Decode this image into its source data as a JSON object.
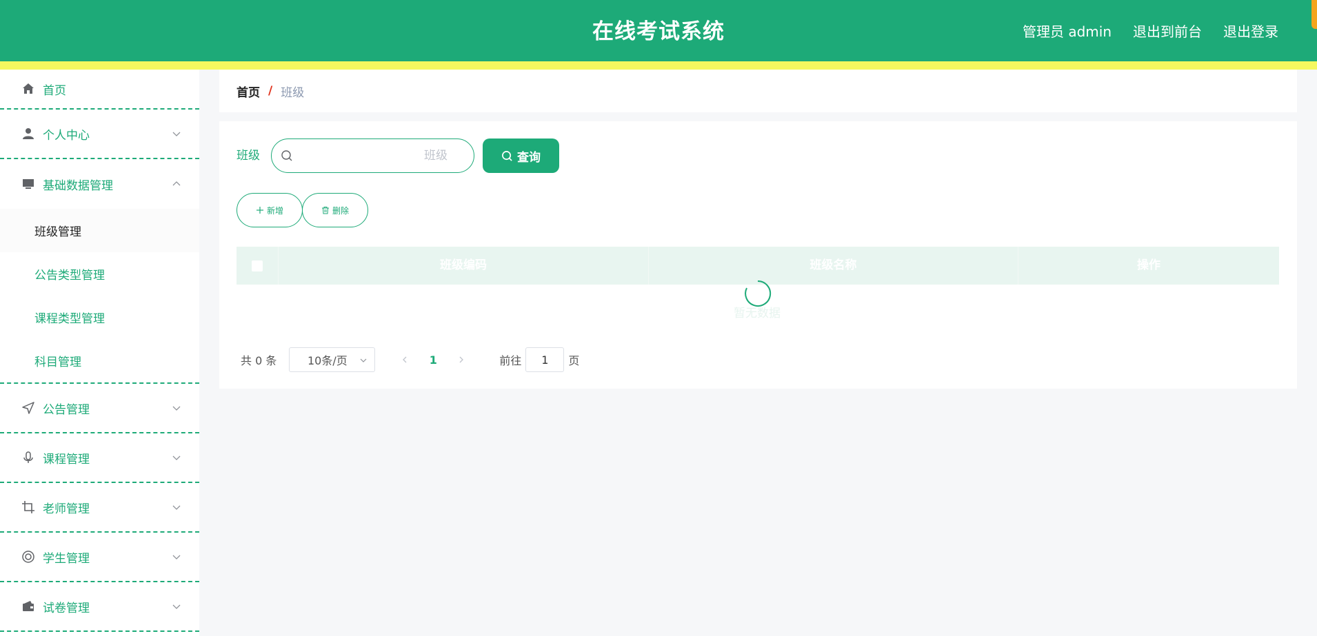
{
  "header": {
    "title": "在线考试系统",
    "admin_label": "管理员 admin",
    "exit_front": "退出到前台",
    "logout": "退出登录",
    "bg_color": "#1daa78",
    "stripe_color": "#f5f85f"
  },
  "sidebar": {
    "home": {
      "label": "首页",
      "icon": "home-icon"
    },
    "groups": [
      {
        "label": "个人中心",
        "icon": "user-icon",
        "expanded": false
      },
      {
        "label": "基础数据管理",
        "icon": "monitor-icon",
        "expanded": true,
        "children": [
          "班级管理",
          "公告类型管理",
          "课程类型管理",
          "科目管理"
        ],
        "active_child": "班级管理"
      },
      {
        "label": "公告管理",
        "icon": "send-icon",
        "expanded": false
      },
      {
        "label": "课程管理",
        "icon": "microphone-icon",
        "expanded": false
      },
      {
        "label": "老师管理",
        "icon": "crop-icon",
        "expanded": false
      },
      {
        "label": "学生管理",
        "icon": "lifebuoy-icon",
        "expanded": false
      },
      {
        "label": "试卷管理",
        "icon": "wallet-icon",
        "expanded": false
      }
    ]
  },
  "breadcrumb": {
    "home": "首页",
    "separator": "/",
    "current": "班级"
  },
  "search": {
    "label": "班级",
    "placeholder": "班级",
    "value": "",
    "button_label": "查询"
  },
  "actions": {
    "add_label": "新增",
    "delete_label": "删除"
  },
  "table": {
    "columns": [
      "班级编码",
      "班级名称",
      "操作"
    ],
    "rows": [],
    "loading_text": "暂无数据"
  },
  "pagination": {
    "total_text": "共 0 条",
    "page_size": "10条/页",
    "current_page": "1",
    "goto_label": "前往",
    "goto_value": "1",
    "page_unit": "页"
  },
  "colors": {
    "accent": "#1daa78",
    "breadcrumb_sep": "#e0321c",
    "corner_tab": "#f4a51d"
  }
}
